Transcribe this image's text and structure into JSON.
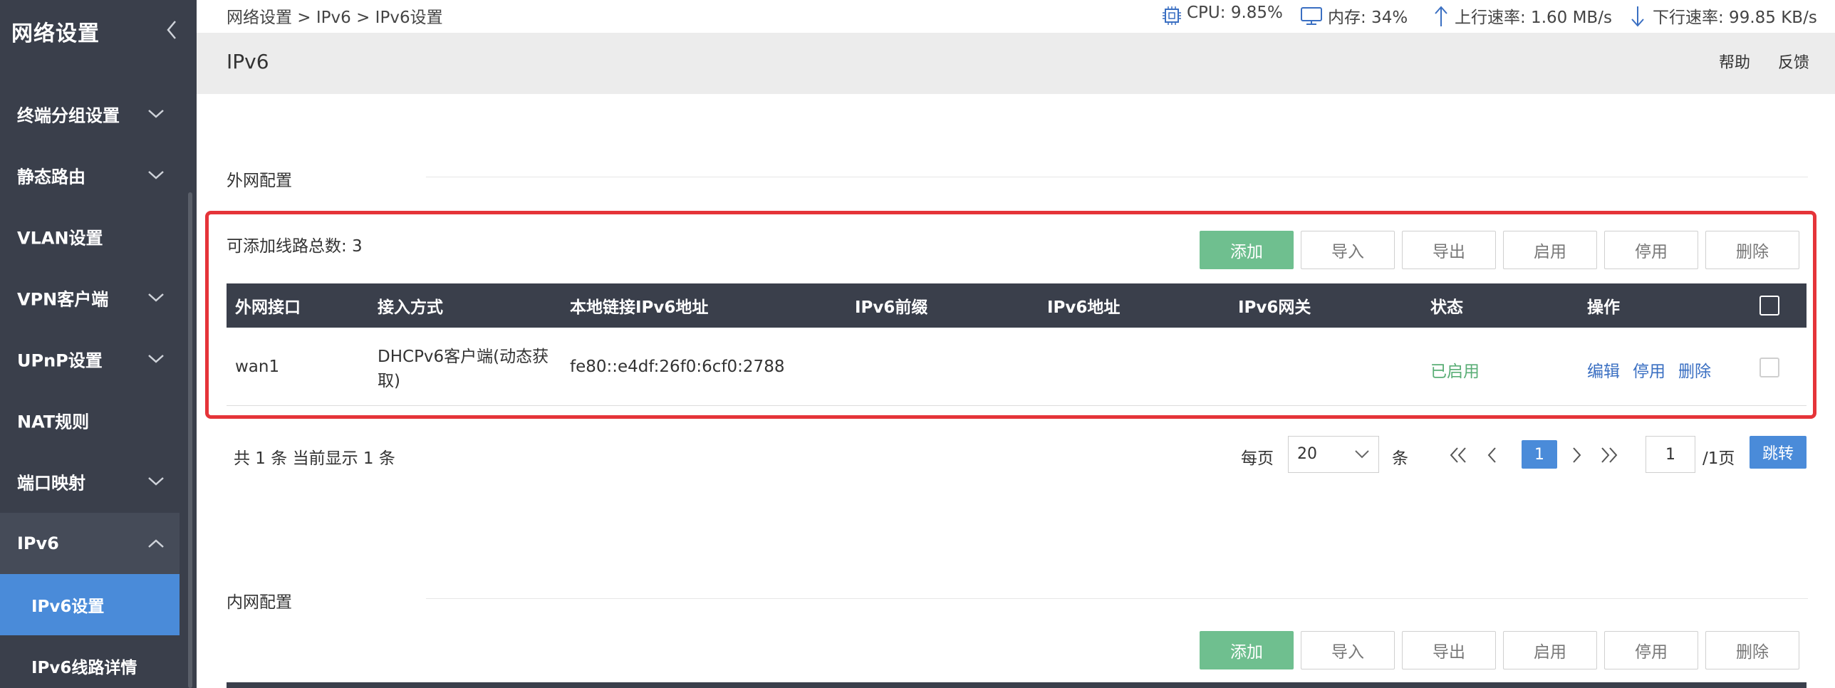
{
  "sidebar": {
    "title": "网络设置",
    "items": [
      {
        "label": "终端分组设置"
      },
      {
        "label": "静态路由"
      },
      {
        "label": "VLAN设置"
      },
      {
        "label": "VPN客户端"
      },
      {
        "label": "UPnP设置"
      },
      {
        "label": "NAT规则"
      },
      {
        "label": "端口映射"
      },
      {
        "label": "IPv6"
      }
    ],
    "subitems": [
      {
        "label": "IPv6设置",
        "active": true
      },
      {
        "label": "IPv6线路详情",
        "active": false
      }
    ]
  },
  "topbar": {
    "breadcrumb": "网络设置 > IPv6 > IPv6设置",
    "cpu": "CPU: 9.85%",
    "memory": "内存: 34%",
    "upload": "上行速率: 1.60 MB/s",
    "download": "下行速率: 99.85 KB/s"
  },
  "page": {
    "title": "IPv6",
    "help": "帮助",
    "feedback": "反馈"
  },
  "wan": {
    "section_title": "外网配置",
    "line_count_text": "可添加线路总数: 3",
    "buttons": {
      "add": "添加",
      "import": "导入",
      "export": "导出",
      "enable": "启用",
      "disable": "停用",
      "delete": "删除"
    },
    "columns": [
      "外网接口",
      "接入方式",
      "本地链接IPv6地址",
      "IPv6前缀",
      "IPv6地址",
      "IPv6网关",
      "状态",
      "操作"
    ],
    "rows": [
      {
        "interface": "wan1",
        "access_line1": "DHCPv6客户端(动态获",
        "access_line2": "取)",
        "link_local": "fe80::e4df:26f0:6cf0:2788",
        "prefix": "",
        "address": "",
        "gateway": "",
        "status": "已启用",
        "ops": {
          "edit": "编辑",
          "disable": "停用",
          "delete": "删除"
        }
      }
    ],
    "pager": {
      "summary": "共 1 条 当前显示 1 条",
      "per_page_label": "每页",
      "per_page_value": "20",
      "per_page_unit": "条",
      "current_page": "1",
      "jump_value": "1",
      "total_pages": "/1页",
      "jump_button": "跳转"
    }
  },
  "lan": {
    "section_title": "内网配置",
    "buttons": {
      "add": "添加",
      "import": "导入",
      "export": "导出",
      "enable": "启用",
      "disable": "停用",
      "delete": "删除"
    }
  },
  "colors": {
    "sidebar_bg": "#3a3f4b",
    "accent_blue": "#4a8bd9",
    "primary_green": "#6fbf8f",
    "status_green": "#5aae76",
    "highlight_red": "#e53439",
    "link_blue": "#3a6fc2"
  }
}
